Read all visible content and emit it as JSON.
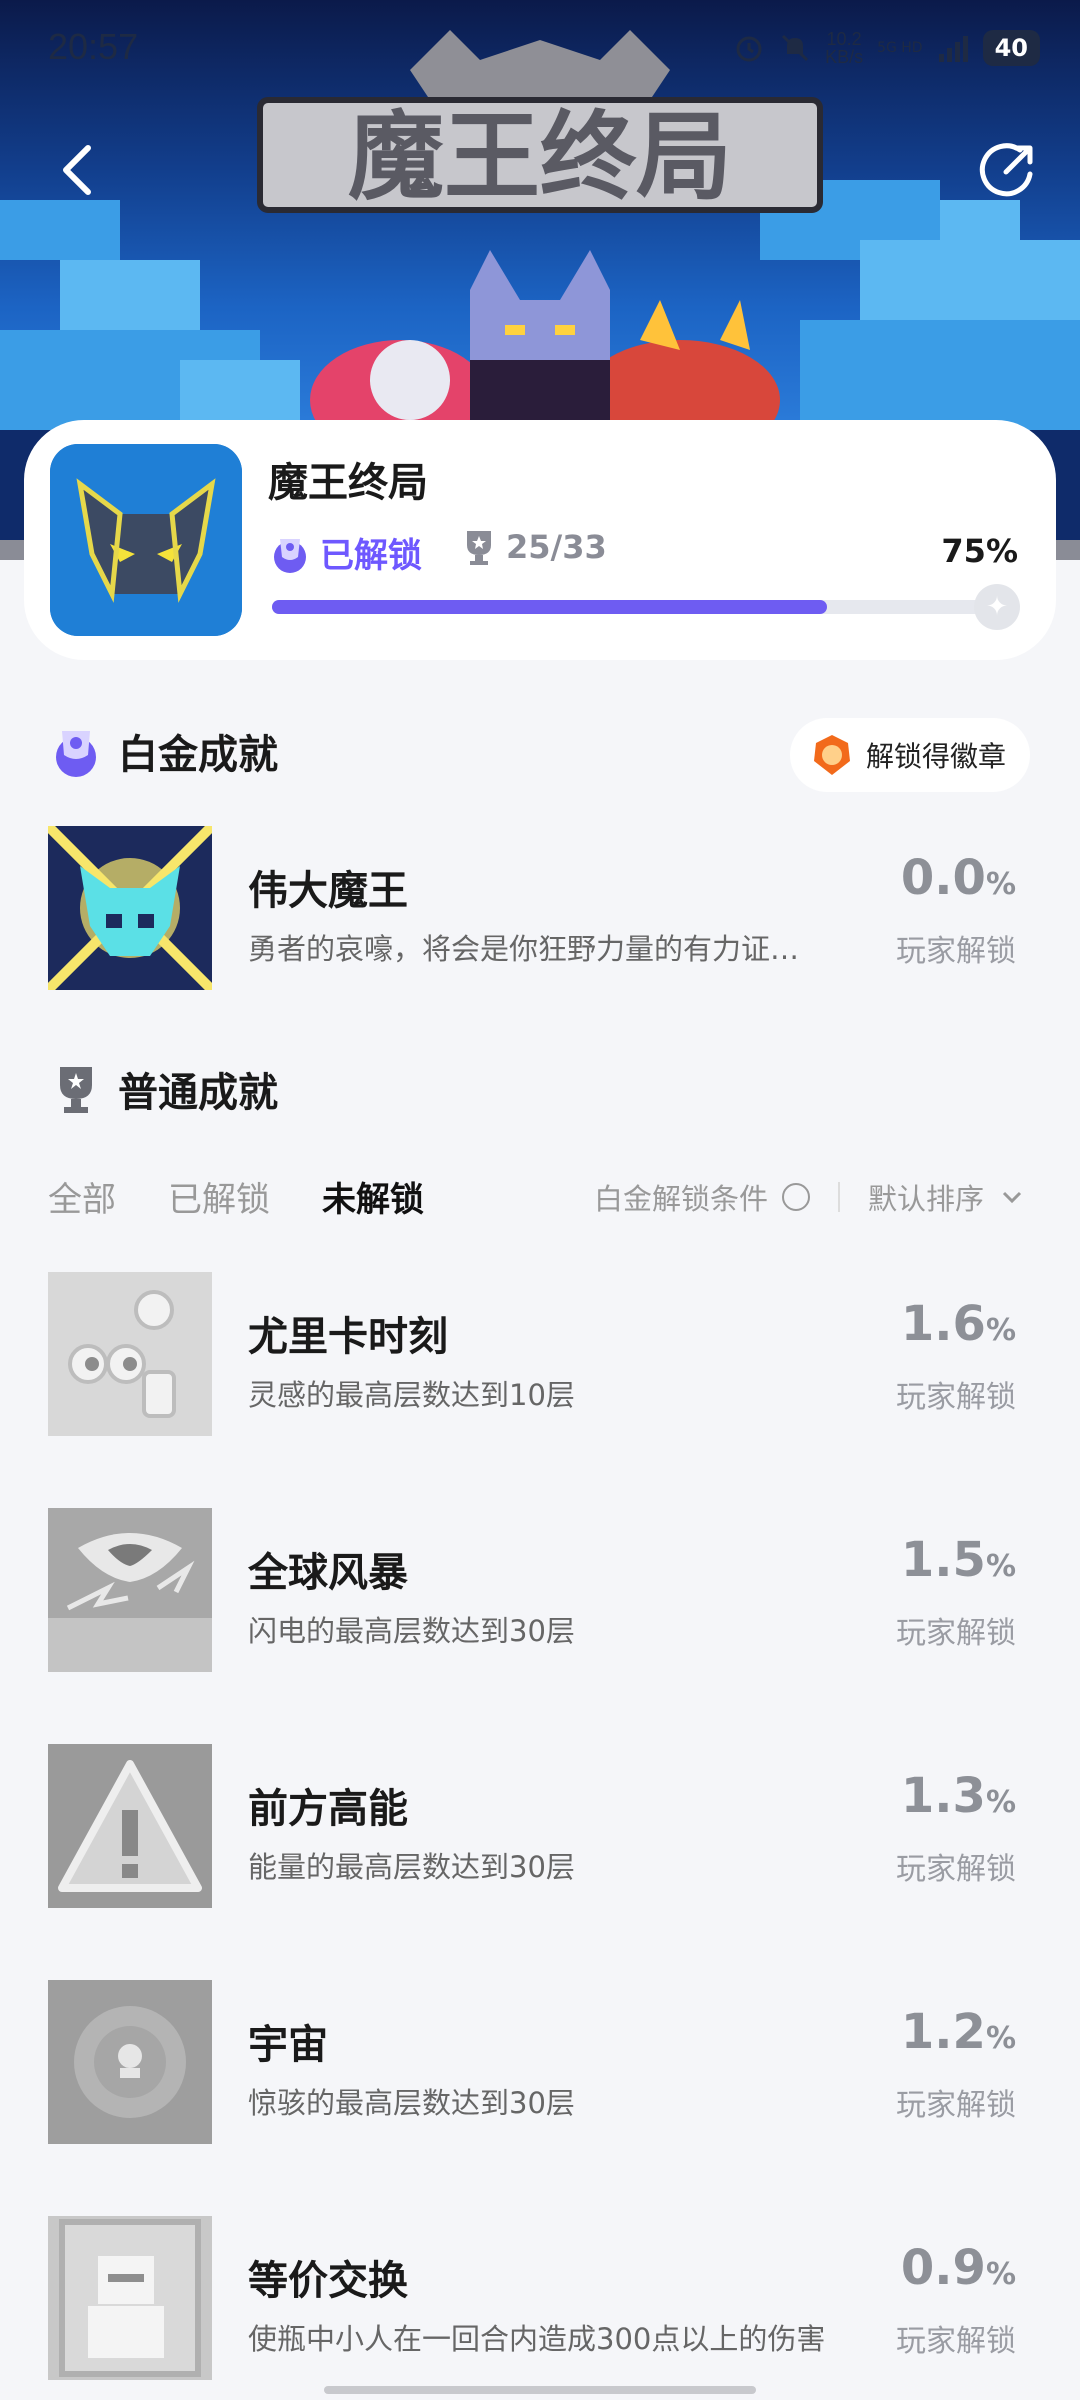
{
  "status_bar": {
    "time": "20:57",
    "speed": "10.2",
    "speed_unit": "KB/s",
    "network": "5G HD",
    "battery": "40"
  },
  "banner": {
    "logo_text": "魔王终局"
  },
  "game": {
    "title": "魔王终局",
    "unlocked_label": "已解锁",
    "trophies": "25/33",
    "percent": "75%",
    "progress": 0.75
  },
  "platinum": {
    "title": "白金成就",
    "badge_button": "解锁得徽章",
    "item": {
      "name": "伟大魔王",
      "desc": "勇者的哀嚎，将会是你狂野力量的有力证…",
      "pct": "0.0",
      "pct_unit": "%",
      "pct_label": "玩家解锁"
    }
  },
  "normal": {
    "title": "普通成就",
    "tabs": [
      "全部",
      "已解锁",
      "未解锁"
    ],
    "active_tab": 2,
    "filter_label": "白金解锁条件",
    "sort_label": "默认排序",
    "items": [
      {
        "name": "尤里卡时刻",
        "desc": "灵感的最高层数达到10层",
        "pct": "1.6",
        "pct_unit": "%",
        "pct_label": "玩家解锁",
        "icon": "lightbulb-eyes-icon"
      },
      {
        "name": "全球风暴",
        "desc": "闪电的最高层数达到30层",
        "pct": "1.5",
        "pct_unit": "%",
        "pct_label": "玩家解锁",
        "icon": "storm-icon"
      },
      {
        "name": "前方高能",
        "desc": "能量的最高层数达到30层",
        "pct": "1.3",
        "pct_unit": "%",
        "pct_label": "玩家解锁",
        "icon": "warning-icon"
      },
      {
        "name": "宇宙",
        "desc": "惊骇的最高层数达到30层",
        "pct": "1.2",
        "pct_unit": "%",
        "pct_label": "玩家解锁",
        "icon": "cosmos-icon"
      },
      {
        "name": "等价交换",
        "desc": "使瓶中小人在一回合内造成300点以上的伤害",
        "pct": "0.9",
        "pct_unit": "%",
        "pct_label": "玩家解锁",
        "icon": "bottle-figure-icon"
      }
    ]
  },
  "colors": {
    "accent": "#6e5cf2",
    "background": "#f5f6f9",
    "muted": "#8d9097"
  }
}
